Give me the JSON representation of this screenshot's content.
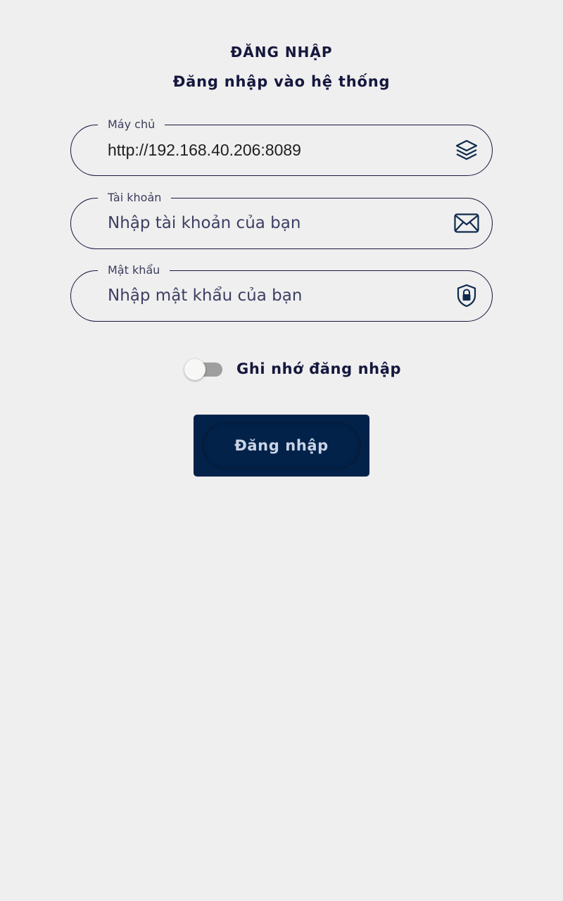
{
  "header": {
    "title": "ĐĂNG NHẬP",
    "subtitle": "Đăng nhập vào hệ thống"
  },
  "form": {
    "server": {
      "label": "Máy chủ",
      "value": "http://192.168.40.206:8089",
      "icon": "layers-icon"
    },
    "account": {
      "label": "Tài khoản",
      "placeholder": "Nhập tài khoản của bạn",
      "icon": "envelope-icon"
    },
    "password": {
      "label": "Mật khẩu",
      "placeholder": "Nhập mật khẩu của bạn",
      "icon": "shield-lock-icon"
    },
    "remember": {
      "label": "Ghi nhớ đăng nhập",
      "checked": false
    },
    "submit_label": "Đăng nhập"
  },
  "colors": {
    "background": "#efefef",
    "primary": "#02224a",
    "text": "#15173d"
  }
}
